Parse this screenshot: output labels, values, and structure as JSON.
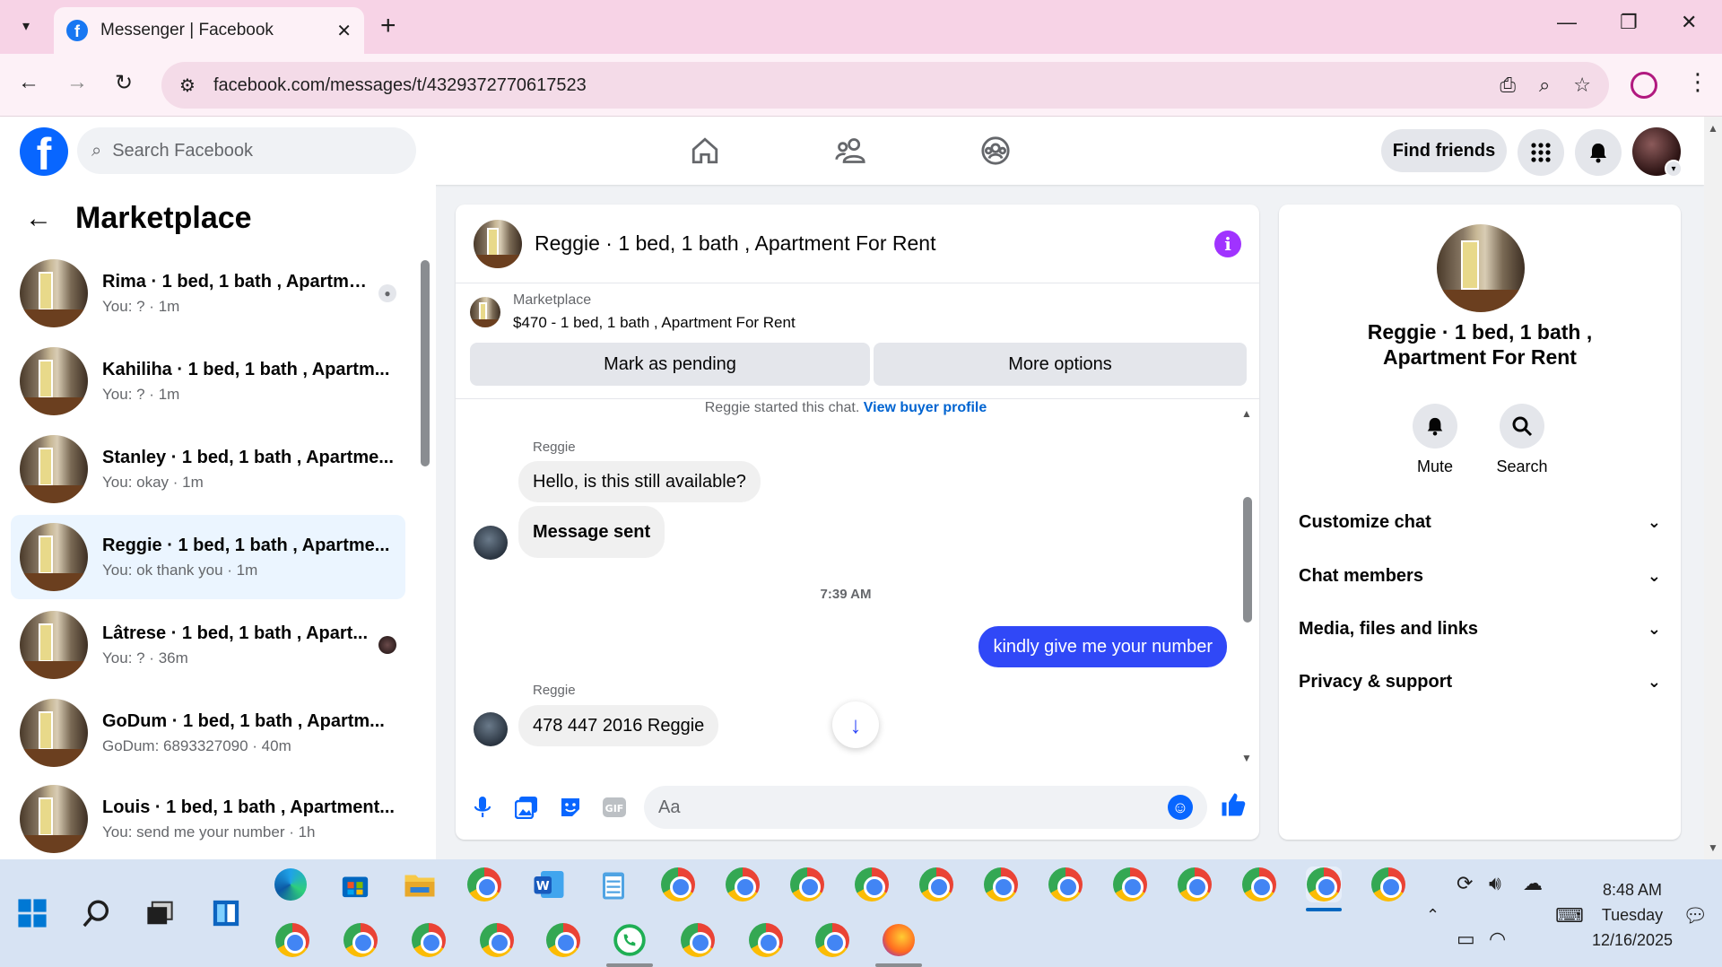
{
  "browser": {
    "tab_title": "Messenger | Facebook",
    "url": "facebook.com/messages/t/4329372770617523"
  },
  "header": {
    "search_placeholder": "Search Facebook",
    "find_friends": "Find friends"
  },
  "sidebar": {
    "title": "Marketplace",
    "conversations": [
      {
        "name": "Rima · 1 bed, 1 bath , Apartme...",
        "sub": "You: ? · 1m"
      },
      {
        "name": "Kahiliha · 1 bed, 1 bath , Apartm...",
        "sub": "You: ? · 1m"
      },
      {
        "name": "Stanley · 1 bed, 1 bath , Apartme...",
        "sub": "You: okay · 1m"
      },
      {
        "name": "Reggie · 1 bed, 1 bath , Apartme...",
        "sub": "You: ok thank you · 1m"
      },
      {
        "name": "Lâtrese · 1 bed, 1 bath , Apart...",
        "sub": "You: ? · 36m"
      },
      {
        "name": "GoDum · 1 bed, 1 bath , Apartm...",
        "sub": "GoDum: 6893327090 · 40m"
      },
      {
        "name": "Louis · 1 bed, 1 bath , Apartment...",
        "sub": "You: send me your number · 1h"
      }
    ]
  },
  "chat": {
    "title": "Reggie · 1 bed, 1 bath , Apartment For Rent",
    "marketplace_label": "Marketplace",
    "listing": "$470 - 1 bed, 1 bath , Apartment For Rent",
    "mark_pending": "Mark as pending",
    "more_options": "More options",
    "started_text": "Reggie started this chat.",
    "view_profile": "View buyer profile",
    "sender": "Reggie",
    "msg1": "Hello, is this still available?",
    "msg2": "Message sent",
    "timestamp": "7:39 AM",
    "msg_mine": "kindly give me your number",
    "sender2": "Reggie",
    "msg3": "478 447 2016 Reggie",
    "composer_placeholder": "Aa"
  },
  "info": {
    "name": "Reggie · 1 bed, 1 bath , Apartment For Rent",
    "mute": "Mute",
    "search": "Search",
    "sections": [
      "Customize chat",
      "Chat members",
      "Media, files and links",
      "Privacy & support"
    ]
  },
  "taskbar": {
    "time": "8:48 AM",
    "day": "Tuesday",
    "date": "12/16/2025"
  }
}
